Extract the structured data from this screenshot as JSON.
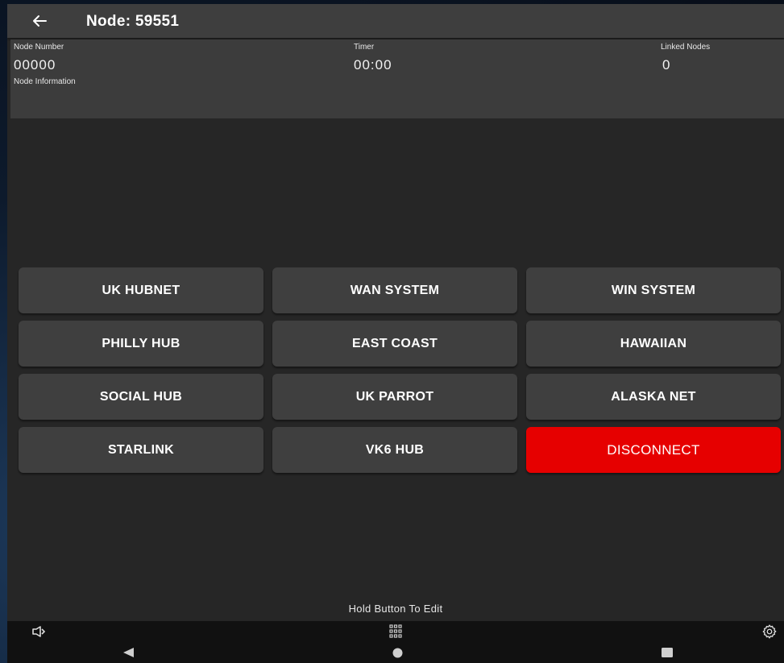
{
  "header": {
    "back_icon": "arrow-left-icon",
    "title": "Node: 59551"
  },
  "info": {
    "node_number_label": "Node Number",
    "node_number_value": "00000",
    "timer_label": "Timer",
    "timer_value": "00:00",
    "linked_nodes_label": "Linked Nodes",
    "linked_nodes_value": "0",
    "node_information_label": "Node Information"
  },
  "buttons": {
    "uk_hubnet": "UK HUBNET",
    "wan_system": "WAN SYSTEM",
    "win_system": "WIN SYSTEM",
    "philly_hub": "PHILLY HUB",
    "east_coast": "EAST COAST",
    "hawaiian": "HAWAIIAN",
    "social_hub": "SOCIAL HUB",
    "uk_parrot": "UK PARROT",
    "alaska_net": "ALASKA NET",
    "starlink": "STARLINK",
    "vk6_hub": "VK6 HUB",
    "disconnect": "DISCONNECT"
  },
  "colors": {
    "disconnect": "#e60000",
    "button": "#3f3f3f",
    "panel": "#3c3c3c",
    "background": "#262626"
  },
  "hint": "Hold Button To Edit",
  "system_bar": {
    "left_icon": "speaker-icon",
    "center_icon": "app-grid-icon",
    "right_icon": "gear-icon"
  },
  "nav_bar": {
    "back": "nav-back-icon",
    "home": "nav-home-icon",
    "recents": "nav-recents-icon"
  }
}
